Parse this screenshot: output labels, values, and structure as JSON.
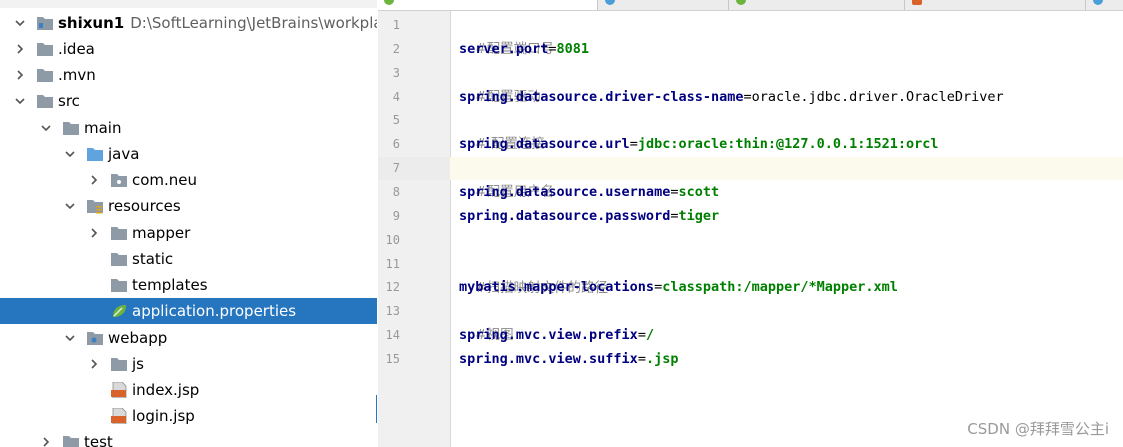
{
  "project_tree": {
    "root": {
      "label": "shixun1",
      "path": "D:\\SoftLearning\\JetBrains\\workplace\\s"
    },
    "items": [
      {
        "label": ".idea"
      },
      {
        "label": ".mvn"
      },
      {
        "label": "src"
      },
      {
        "label": "main"
      },
      {
        "label": "java"
      },
      {
        "label": "com.neu"
      },
      {
        "label": "resources"
      },
      {
        "label": "mapper"
      },
      {
        "label": "static"
      },
      {
        "label": "templates"
      },
      {
        "label": "application.properties"
      },
      {
        "label": "webapp"
      },
      {
        "label": "js"
      },
      {
        "label": "index.jsp"
      },
      {
        "label": "login.jsp"
      },
      {
        "label": "test"
      }
    ],
    "selected": "application.properties"
  },
  "editor": {
    "lines": [
      {
        "n": "1",
        "comment": "#配置端口号"
      },
      {
        "n": "2",
        "key": "server.port",
        "value": "8081"
      },
      {
        "n": "3",
        "comment": "#配置驱动"
      },
      {
        "n": "4",
        "key": "spring.datasource.driver-class-name",
        "value": "oracle.jdbc.driver.OracleDriver"
      },
      {
        "n": "5",
        "comment": "# 配置连接"
      },
      {
        "n": "6",
        "key": "spring.datasource.url",
        "value": "jdbc:oracle:thin:@127.0.0.1:1521:orcl"
      },
      {
        "n": "7",
        "comment": "#配置用户名"
      },
      {
        "n": "8",
        "key": "spring.datasource.username",
        "value": "scott"
      },
      {
        "n": "9",
        "key": "spring.datasource.password",
        "value": "tiger"
      },
      {
        "n": "10"
      },
      {
        "n": "11",
        "comment": "#扫描映射文件的路径"
      },
      {
        "n": "12",
        "key": "mybatis.mapper-locations",
        "value": "classpath:/mapper/*Mapper.xml"
      },
      {
        "n": "13",
        "comment": "#视图"
      },
      {
        "n": "14",
        "key": "spring.mvc.view.prefix",
        "value": "/"
      },
      {
        "n": "15",
        "key": "spring.mvc.view.suffix",
        "value": ".jsp"
      }
    ],
    "equals": "=",
    "caret_line": "7"
  },
  "watermark": "CSDN @拜拜雪公主i",
  "colors": {
    "selection": "#2675bf",
    "key": "#000080",
    "value": "#008000",
    "comment": "#8c8c8c",
    "caret_line_bg": "#fcfaed",
    "gutter_bg": "#f0f0f0"
  }
}
